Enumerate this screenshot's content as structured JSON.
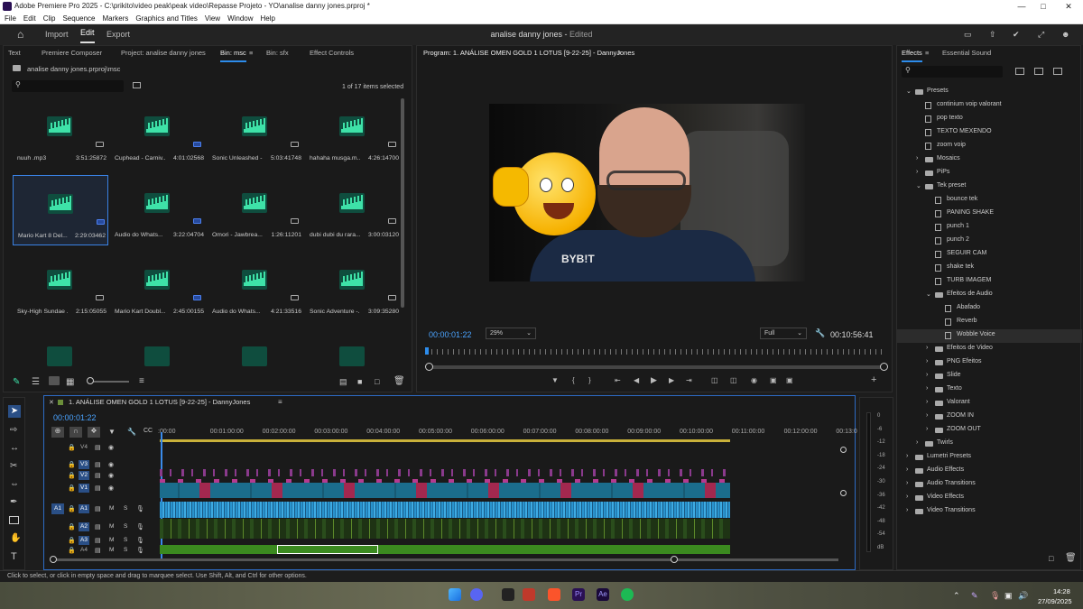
{
  "window": {
    "title": "Adobe Premiere Pro 2025 - C:\\prikito\\video peak\\peak video\\Repasse Projeto - YO\\analise danny jones.prproj *"
  },
  "menu": [
    "File",
    "Edit",
    "Clip",
    "Sequence",
    "Markers",
    "Graphics and Titles",
    "View",
    "Window",
    "Help"
  ],
  "app": {
    "home_label": "Home",
    "nav": [
      "Import",
      "Edit",
      "Export"
    ],
    "project_title": "analise danny jones",
    "edited": "Edited",
    "title_sep": " - "
  },
  "project_panel": {
    "tabs": [
      "Text",
      "Premiere Composer",
      "Project: analise danny jones",
      "Bin: msc",
      "Bin: sfx",
      "Effect Controls"
    ],
    "path": "analise danny jones.prproj\\msc",
    "items_selected": "1 of 17 items selected",
    "tiles": [
      {
        "name": "nuuh .mp3",
        "dur": "3:51:25872"
      },
      {
        "name": "Cuphead - Carniv...",
        "dur": "4:01:02568"
      },
      {
        "name": "Sonic Unleashed -...",
        "dur": "5:03:41748"
      },
      {
        "name": "hahaha musga.m...",
        "dur": "4:26:14700"
      },
      {
        "name": "Mario Kart 8 Del...",
        "dur": "2:29:03462"
      },
      {
        "name": "Áudio do Whats...",
        "dur": "3:22:04704"
      },
      {
        "name": "Omori - Jawbrea...",
        "dur": "1:26:11201"
      },
      {
        "name": "dubi dubi du rara...",
        "dur": "3:00:03120"
      },
      {
        "name": "Sky-High Sundae ...",
        "dur": "2:15:05055"
      },
      {
        "name": "Mario Kart Doubl...",
        "dur": "2:45:00155"
      },
      {
        "name": "Áudio do Whats...",
        "dur": "4:21:33516"
      },
      {
        "name": "Sonic Adventure -...",
        "dur": "3:09:35280"
      }
    ]
  },
  "program_monitor": {
    "title": "Program: 1. ANÁLISE OMEN GOLD 1 LOTUS [9-22-25] - DannyJones",
    "timecode": "00:00:01:22",
    "zoom": "29%",
    "quality": "Full",
    "duration": "00:10:56:41",
    "shirt_text": "BYB!T"
  },
  "effects_panel": {
    "tabs": [
      "Effects",
      "Essential Sound"
    ],
    "items": [
      {
        "label": "Presets",
        "level": 0,
        "open": true,
        "folder": true
      },
      {
        "label": "continium voip valorant",
        "level": 1
      },
      {
        "label": "pop texto",
        "level": 1
      },
      {
        "label": "TEXTO MEXENDO",
        "level": 1
      },
      {
        "label": "zoom voip",
        "level": 1
      },
      {
        "label": "Mosaics",
        "level": 1,
        "folder": true
      },
      {
        "label": "PiPs",
        "level": 1,
        "folder": true
      },
      {
        "label": "Tek preset",
        "level": 1,
        "open": true,
        "folder": true
      },
      {
        "label": "bounce tek",
        "level": 2
      },
      {
        "label": "PANING SHAKE",
        "level": 2
      },
      {
        "label": "punch 1",
        "level": 2
      },
      {
        "label": "punch 2",
        "level": 2
      },
      {
        "label": "SEGUIR CAM",
        "level": 2
      },
      {
        "label": "shake tek",
        "level": 2
      },
      {
        "label": "TURB IMAGEM",
        "level": 2
      },
      {
        "label": "Efeitos de Audio",
        "level": 2,
        "open": true,
        "folder": true
      },
      {
        "label": "Abafado",
        "level": 3
      },
      {
        "label": "Reverb",
        "level": 3
      },
      {
        "label": "Wobble Voice",
        "level": 3,
        "selected": true
      },
      {
        "label": "Efeitos de Video",
        "level": 2,
        "folder": true
      },
      {
        "label": "PNG Efeitos",
        "level": 2,
        "folder": true
      },
      {
        "label": "Slide",
        "level": 2,
        "folder": true
      },
      {
        "label": "Texto",
        "level": 2,
        "folder": true
      },
      {
        "label": "Valorant",
        "level": 2,
        "folder": true
      },
      {
        "label": "ZOOM IN",
        "level": 2,
        "folder": true
      },
      {
        "label": "ZOOM OUT",
        "level": 2,
        "folder": true
      },
      {
        "label": "Twirls",
        "level": 1,
        "folder": true
      },
      {
        "label": "Lumetri Presets",
        "level": 0,
        "folder": true
      },
      {
        "label": "Audio Effects",
        "level": 0,
        "folder": true
      },
      {
        "label": "Audio Transitions",
        "level": 0,
        "folder": true
      },
      {
        "label": "Video Effects",
        "level": 0,
        "folder": true
      },
      {
        "label": "Video Transitions",
        "level": 0,
        "folder": true
      }
    ]
  },
  "timeline": {
    "sequence_name": "1. ANÁLISE OMEN GOLD 1 LOTUS [9-22-25] - DannyJones",
    "timecode": "00:00:01:22",
    "ruler": [
      ":00:00",
      "00:01:00:00",
      "00:02:00:00",
      "00:03:00:00",
      "00:04:00:00",
      "00:05:00:00",
      "00:06:00:00",
      "00:07:00:00",
      "00:08:00:00",
      "00:09:00:00",
      "00:10:00:00",
      "00:11:00:00",
      "00:12:00:00",
      "00:13:0"
    ],
    "video_tracks": [
      "V4",
      "V3",
      "V2",
      "V1"
    ],
    "audio_tracks": [
      "A1",
      "A2",
      "A3",
      "A4"
    ],
    "src_patch": [
      "A1"
    ],
    "track_btn_m": "M",
    "track_btn_s": "S"
  },
  "meter": {
    "scale": [
      "0",
      "-6",
      "-12",
      "-18",
      "-24",
      "-30",
      "-36",
      "-42",
      "-48",
      "-54",
      "dB"
    ]
  },
  "status": "Click to select, or click in empty space and drag to marquee select. Use Shift, Alt, and Ctrl for other options.",
  "taskbar": {
    "time": "14:28",
    "date": "27/09/2025"
  }
}
